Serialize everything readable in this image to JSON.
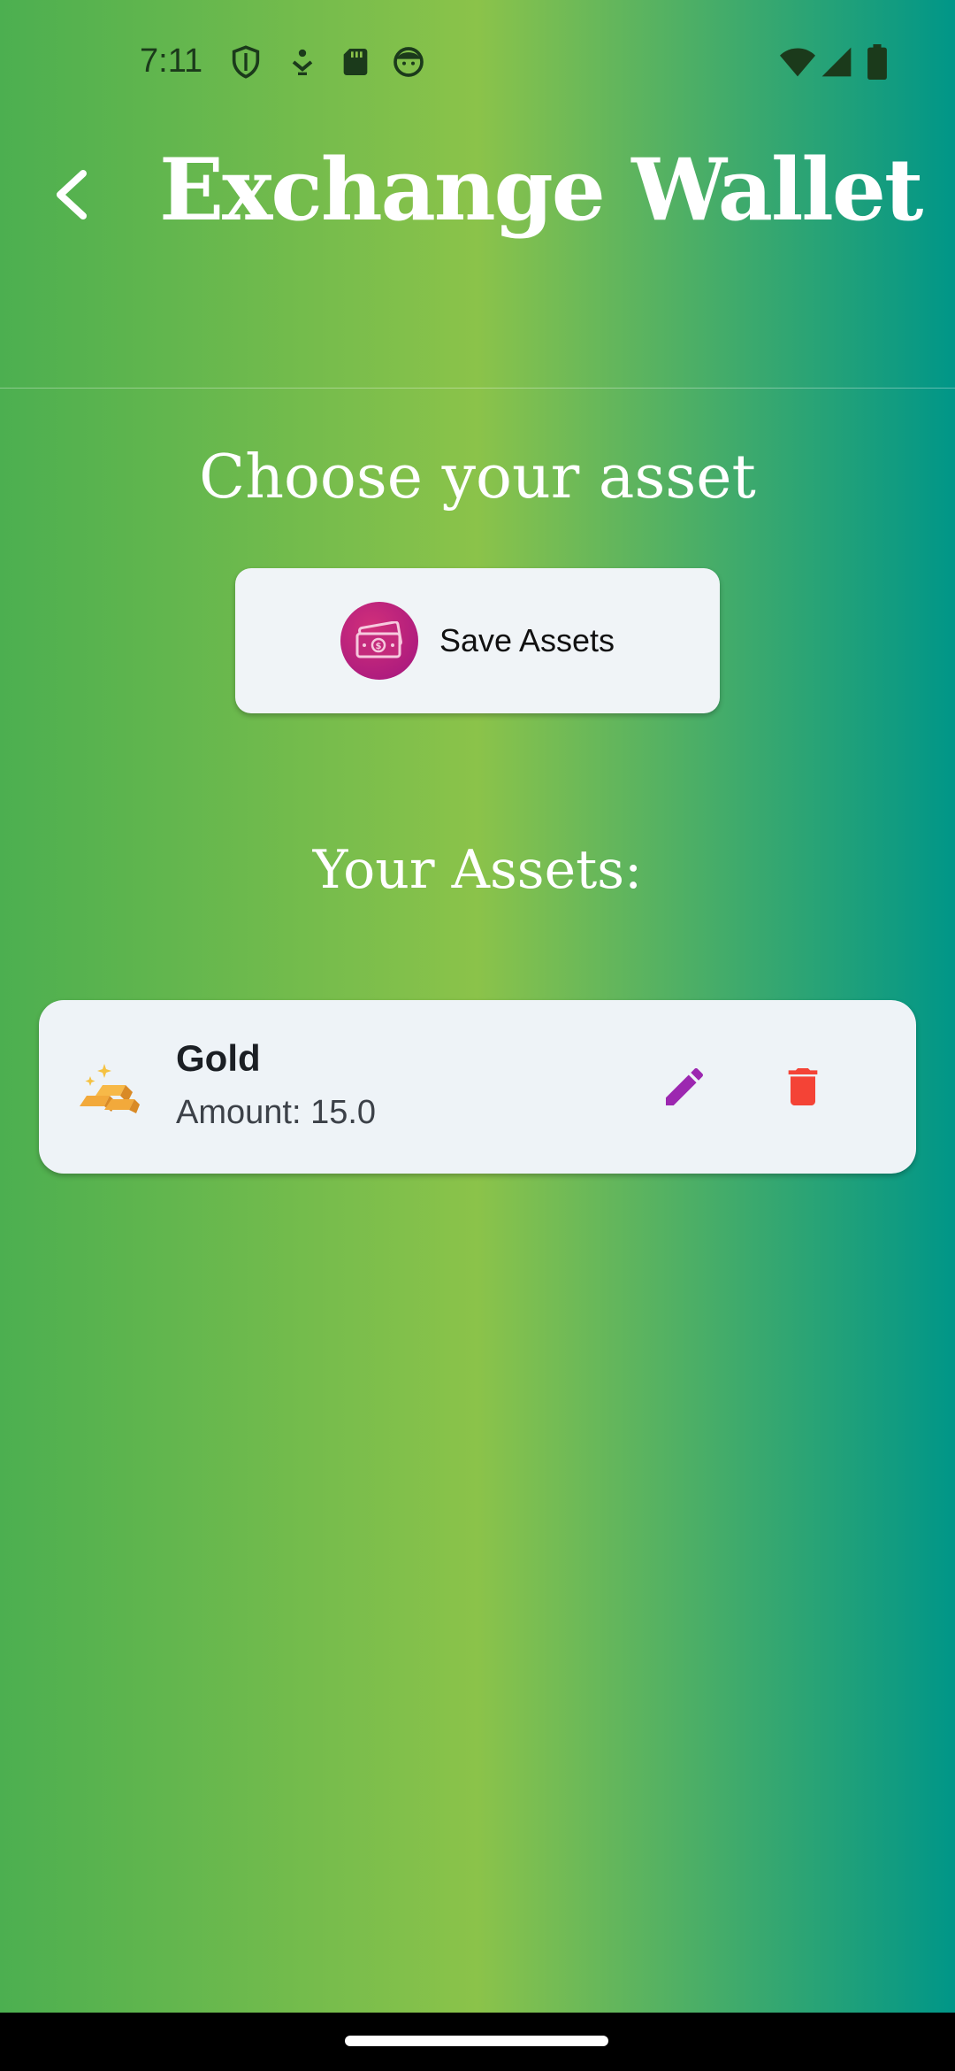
{
  "status_bar": {
    "time": "7:11",
    "left_icons": [
      "shield-icon",
      "download-icon",
      "sd-card-icon",
      "face-icon"
    ],
    "right_icons": [
      "wifi-icon",
      "signal-icon",
      "battery-icon"
    ]
  },
  "app_bar": {
    "title": "Exchange Wallet",
    "back_icon": "chevron-left-icon"
  },
  "choose": {
    "heading": "Choose your asset",
    "button_label": "Save Assets",
    "button_icon": "money-icon"
  },
  "assets": {
    "heading": "Your Assets:",
    "items": [
      {
        "name": "Gold",
        "amount_text": "Amount: 15.0",
        "icon": "gold-bars-icon"
      }
    ]
  },
  "colors": {
    "gradient_left": "#4caf50",
    "gradient_mid": "#8bc34a",
    "gradient_right": "#009688",
    "card_bg": "#eef3f7",
    "edit_icon": "#9c27b0",
    "delete_icon": "#f44336",
    "money_avatar": "#b5197e"
  }
}
